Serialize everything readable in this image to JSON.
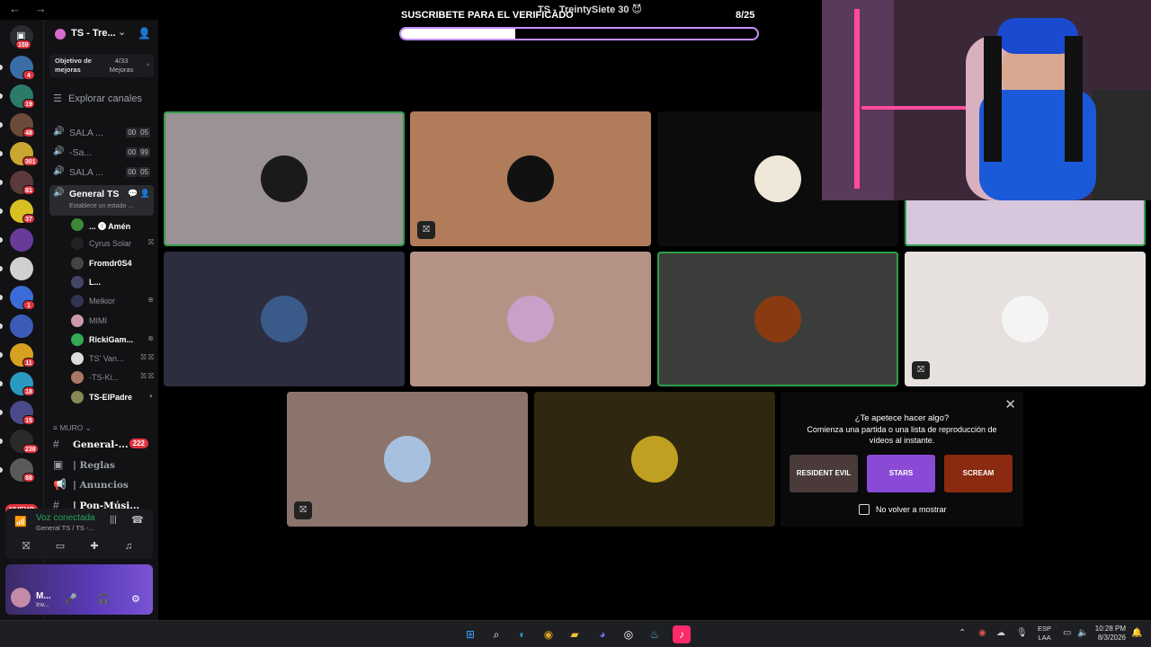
{
  "titlebar": {
    "nav": "← →",
    "title": "TS - TreintySiete 30 😈"
  },
  "rail": {
    "top_badge": "159",
    "servers": [
      {
        "badge": "4",
        "color": "#3a6ea8"
      },
      {
        "badge": "19",
        "color": "#2c7b6a"
      },
      {
        "badge": "48",
        "color": "#6b4a3a"
      },
      {
        "badge": "301",
        "color": "#c9a630"
      },
      {
        "badge": "81",
        "color": "#5a3a3a"
      },
      {
        "badge": "37",
        "color": "#d8c020"
      },
      {
        "badge": "",
        "color": "#6a3a9a"
      },
      {
        "badge": "",
        "color": "#d0d0d0"
      },
      {
        "badge": "1",
        "color": "#3b6bd6"
      },
      {
        "badge": "",
        "color": "#3b5bb6"
      },
      {
        "badge": "11",
        "color": "#d8a020"
      },
      {
        "badge": "18",
        "color": "#2a9ac0"
      },
      {
        "badge": "15",
        "color": "#4a4a8a"
      },
      {
        "badge": "238",
        "color": "#2a2a2a"
      },
      {
        "badge": "88",
        "color": "#5a5a5a"
      }
    ],
    "new_label": "NUEVO"
  },
  "sidebar": {
    "server_name": "TS - Tre...",
    "boost": {
      "goal": "Objetivo de mejoras",
      "count": "4/33 Mejoras",
      "chevron": "›"
    },
    "explore": "Explorar canales",
    "voice_channels": [
      {
        "name": "SALA ...",
        "c1": "00",
        "c2": "05"
      },
      {
        "name": "-Sa...",
        "c1": "00",
        "c2": "99"
      },
      {
        "name": "SALA ...",
        "c1": "00",
        "c2": "05"
      }
    ],
    "active_channel": {
      "name": "General TS",
      "status": "Establece un estado ..."
    },
    "members": [
      {
        "name": "... 🅨 Amén",
        "color": "#3a8a3a"
      },
      {
        "name": "Cyrus Solar",
        "color": "#222"
      },
      {
        "name": "Fromdr0S4",
        "color": "#444"
      },
      {
        "name": "L...",
        "color": "#446"
      },
      {
        "name": "Melkior",
        "color": "#335"
      },
      {
        "name": "MIMI",
        "color": "#c9a"
      },
      {
        "name": "RickiGam...",
        "color": "#3a5"
      },
      {
        "name": "TS' Van...",
        "color": "#ddd"
      },
      {
        "name": "-TS-Ki...",
        "color": "#a76"
      },
      {
        "name": "TS-ElPadre",
        "color": "#885"
      }
    ],
    "section": "MURO",
    "text_channels": [
      {
        "name": "General-...",
        "badge": "222"
      },
      {
        "name": "| Reglas",
        "badge": ""
      },
      {
        "name": "| Anuncios",
        "badge": ""
      },
      {
        "name": "| Pon-Músi...",
        "badge": ""
      }
    ],
    "voice_panel": {
      "status": "Voz conectada",
      "location": "General TS / TS -..."
    },
    "user_panel": {
      "name": "M...",
      "status": "Inv..."
    }
  },
  "overlay": {
    "subtitle": "SUSCRIBETE PARA EL VERIFICADO",
    "goal": "8/25",
    "progress": 0.32
  },
  "tiles": [
    {
      "name": "tile-1",
      "bg": "#9a9295",
      "avatar": "#1a1a1a",
      "speaking": true,
      "muted": false
    },
    {
      "name": "tile-cyrus",
      "bg": "#b07c5a",
      "avatar": "#111",
      "speaking": false,
      "muted": true
    },
    {
      "name": "tile-anon",
      "bg": "#0c0c0c",
      "avatar": "#efe8d8",
      "speaking": false,
      "muted": false
    },
    {
      "name": "tile-4",
      "bg": "#d8c6dc",
      "avatar": "",
      "speaking": true,
      "muted": false
    },
    {
      "name": "tile-melkior",
      "bg": "#2c2d3f",
      "avatar": "#3a5a8a",
      "speaking": false,
      "muted": false
    },
    {
      "name": "tile-mimi",
      "bg": "#b59286",
      "avatar": "#c8a0c8",
      "speaking": false,
      "muted": false
    },
    {
      "name": "tile-skull",
      "bg": "#3b3d3b",
      "avatar": "#8a3a10",
      "speaking": true,
      "muted": false
    },
    {
      "name": "tile-8",
      "bg": "#e6e1de",
      "avatar": "#f4f4f4",
      "speaking": false,
      "muted": true
    },
    {
      "name": "tile-9",
      "bg": "#8a746b",
      "avatar": "#a8c0e0",
      "speaking": false,
      "muted": true
    },
    {
      "name": "tile-chica",
      "bg": "#2f2710",
      "avatar": "#c0a020",
      "speaking": false,
      "muted": false
    }
  ],
  "activity": {
    "heading": "¿Te apetece hacer algo?",
    "description": "Comienza una partida o una lista de reproducción de vídeos al instante.",
    "games": [
      {
        "label": "RESIDENT EVIL",
        "color": "#4a3a3a"
      },
      {
        "label": "STARS",
        "color": "#8a4ad6"
      },
      {
        "label": "SCREAM",
        "color": "#8a2a10"
      }
    ],
    "checkbox": "No volver a mostrar"
  },
  "taskbar": {
    "lang": "ESP\nLAA",
    "time": "10:28 PM",
    "date": "8/3/2026"
  }
}
